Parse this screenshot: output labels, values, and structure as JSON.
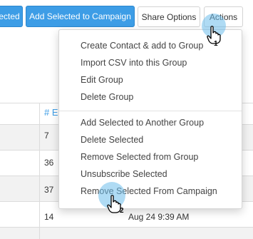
{
  "toolbar": {
    "partial_label": "ected",
    "add_campaign_label": "Add Selected to Campaign",
    "share_label": "Share Options",
    "actions_label": "Actions"
  },
  "table": {
    "header": "# E",
    "cells": [
      "7",
      "36",
      "37",
      "14"
    ],
    "date": "Aug 24 9:39 AM"
  },
  "menu": {
    "group1": [
      "Create Contact & add to Group",
      "Import CSV into this Group",
      "Edit Group",
      "Delete Group"
    ],
    "group2": [
      "Add Selected to Another Group",
      "Delete Selected",
      "Remove Selected from Group",
      "Unsubscribe Selected",
      "Remove Selected From Campaign"
    ]
  },
  "annotations": {
    "step1": "1",
    "step2": "2"
  },
  "colors": {
    "accent": "#3d9de6",
    "marker": "#6ebeeb"
  }
}
